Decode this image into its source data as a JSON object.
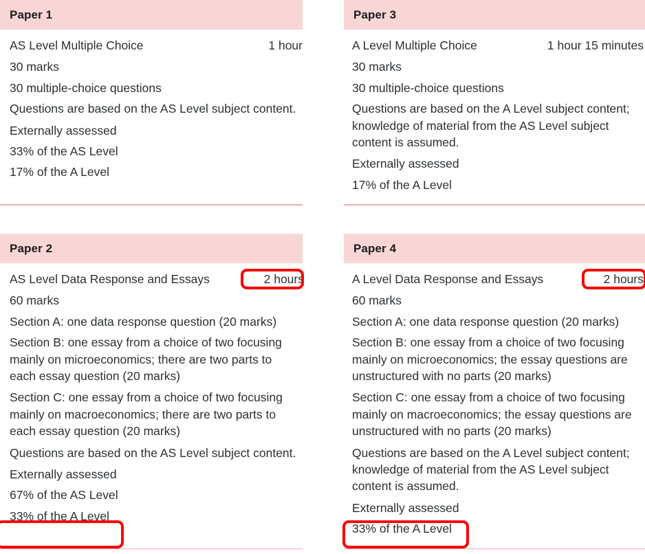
{
  "theme": {
    "header_band": "#f9d6d6",
    "divider": "#f0aab2",
    "text": "#2b3034",
    "annotation": "#f90606"
  },
  "panels": {
    "paper1": {
      "title": "Paper 1",
      "headline": "AS Level Multiple Choice",
      "duration": "1 hour",
      "lines": [
        "30 marks",
        "30 multiple-choice questions",
        "Questions are based on the AS Level subject content.",
        "Externally assessed",
        "33% of the AS Level",
        "17% of the A Level"
      ]
    },
    "paper3": {
      "title": "Paper 3",
      "headline": "A Level Multiple Choice",
      "duration": "1 hour 15 minutes",
      "lines": [
        "30 marks",
        "30 multiple-choice questions",
        "Questions are based on the A Level subject content; knowledge of material from the AS Level subject content is assumed.",
        "Externally assessed",
        "17% of the A Level"
      ]
    },
    "paper2": {
      "title": "Paper 2",
      "headline": "AS Level Data Response and Essays",
      "duration": "2 hours",
      "lines": [
        "60 marks",
        "Section A: one data response question (20 marks)",
        "Section B: one essay from a choice of two focusing mainly on microeconomics; there are two parts to each essay question (20 marks)",
        "Section C: one essay from a choice of two focusing mainly on macroeconomics; there are two parts to each essay question (20 marks)",
        "Questions are based on the AS Level subject content.",
        "Externally assessed",
        "67% of the AS Level",
        "33% of the A Level"
      ]
    },
    "paper4": {
      "title": "Paper 4",
      "headline": "A Level Data Response and Essays",
      "duration": "2 hours",
      "lines": [
        "60 marks",
        "Section A: one data response question (20 marks)",
        "Section B: one essay from a choice of two focusing mainly on microeconomics; the essay questions are unstructured with no parts (20 marks)",
        "Section C: one essay from a choice of two focusing mainly on macroeconomics; the essay questions are unstructured with no parts (20 marks)",
        "Questions are based on the A Level subject content; knowledge of material from the AS Level subject content is assumed.",
        "Externally assessed",
        "33% of the A Level"
      ]
    }
  },
  "annotations": [
    {
      "name": "paper2-duration-highlight",
      "target": "2 hours"
    },
    {
      "name": "paper4-duration-highlight",
      "target": "2 hours"
    },
    {
      "name": "paper2-a-level-weight-highlight",
      "target": "33% of the A Level"
    },
    {
      "name": "paper4-a-level-weight-highlight",
      "target": "33% of the A Level"
    }
  ]
}
